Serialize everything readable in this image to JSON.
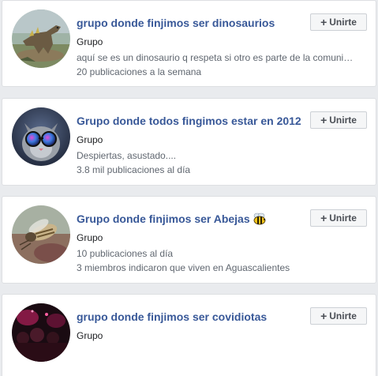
{
  "groups": [
    {
      "name": "grupo donde finjimos ser dinosaurios",
      "type": "Grupo",
      "description": "aquí se es un dinosaurio q respeta si otro es parte de la comuni…",
      "activity": "20 publicaciones a la semana",
      "join_label": "Unirte"
    },
    {
      "name": "Grupo donde todos fingimos estar en 2012",
      "type": "Grupo",
      "description": "Despiertas, asustado....",
      "activity": "3.8 mil publicaciones al día",
      "join_label": "Unirte"
    },
    {
      "name": "Grupo donde finjimos ser Abejas",
      "type": "Grupo",
      "activity": "10 publicaciones al día",
      "members_note": "3 miembros indicaron que viven en Aguascalientes",
      "join_label": "Unirte",
      "title_icon": "bee-emoji-icon"
    },
    {
      "name": "grupo donde finjimos ser covidiotas",
      "type": "Grupo",
      "join_label": "Unirte"
    }
  ],
  "colors": {
    "link": "#385898",
    "secondary_text": "#606770",
    "button_bg": "#f5f6f7",
    "page_bg": "#e9ebee"
  }
}
